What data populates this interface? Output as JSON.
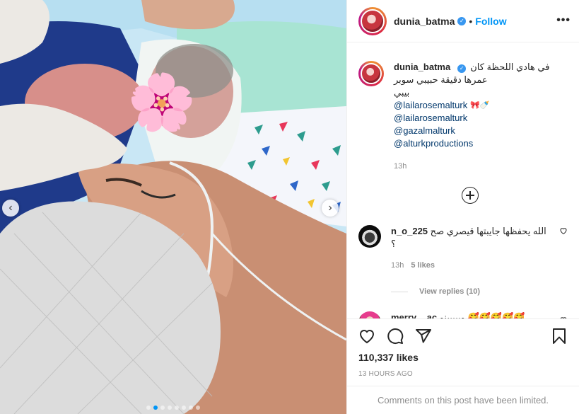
{
  "post": {
    "username": "dunia_batma",
    "follow_label": "Follow",
    "bullet": "•",
    "more_label": "•••"
  },
  "caption": {
    "username": "dunia_batma",
    "text_line1": "في هادي اللحظة كان",
    "text_line2": "عمرها دقيقة حبيبي سوبر بيبي",
    "mentions": [
      "@lailarosemalturk",
      "@lailarosemalturk",
      "@gazalmalturk",
      "@alturkproductions"
    ],
    "mention_emoji": "🎀🍼",
    "time": "13h"
  },
  "comments": [
    {
      "username": "n_o_225",
      "text": "الله يحفظها جايبتها قيصري صح ؟",
      "time": "13h",
      "likes": "5 likes",
      "view_replies": "View replies (10)"
    },
    {
      "username": "merry__ac",
      "text": "وبيييينو",
      "emojis": "🥰🥰🥰🥰🥰"
    }
  ],
  "likes_count": "110,337 likes",
  "posted_ago": "13 HOURS AGO",
  "comments_limited": "Comments on this post have been limited.",
  "media": {
    "prev_arrow": "‹",
    "next_arrow": "›",
    "carousel_total": 8,
    "carousel_active": 1,
    "sticker_flower": "🌸"
  },
  "colors": {
    "accent_blue": "#0095f6",
    "mention_blue": "#00376b",
    "muted_gray": "#8e8e8e",
    "text_dark": "#262626",
    "border": "#efefef"
  }
}
